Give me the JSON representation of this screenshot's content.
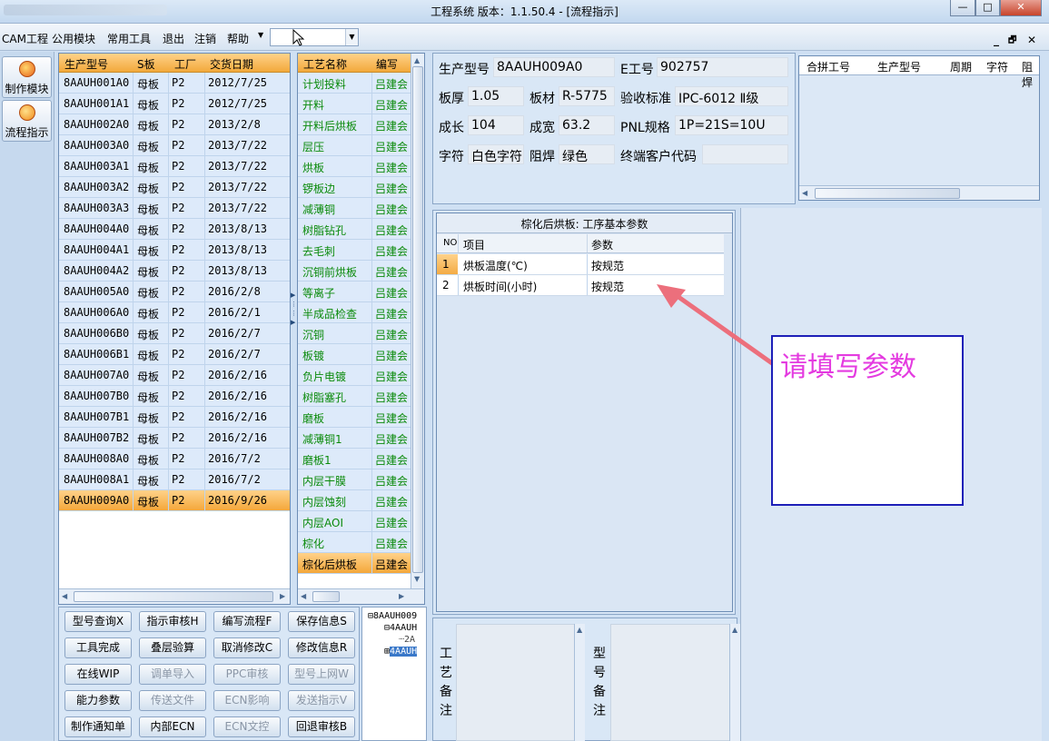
{
  "window": {
    "title": "工程系统  版本：1.1.50.4 - [流程指示]",
    "btn_min": "—",
    "btn_max": "□",
    "btn_close": "✕"
  },
  "menu": {
    "items": [
      "CAM工程",
      "公用模块",
      "常用工具",
      "退出",
      "注销",
      "帮助"
    ],
    "combo_value": "",
    "mdi_min": "_",
    "mdi_restore": "🗗",
    "mdi_close": "✕"
  },
  "sidebar": {
    "items": [
      {
        "label": "制作模块"
      },
      {
        "label": "流程指示"
      }
    ]
  },
  "product_table": {
    "columns": [
      "生产型号",
      "S板",
      "工厂",
      "交货日期"
    ],
    "rows": [
      [
        "8AAUH001A0",
        "母板",
        "P2",
        "2012/7/25"
      ],
      [
        "8AAUH001A1",
        "母板",
        "P2",
        "2012/7/25"
      ],
      [
        "8AAUH002A0",
        "母板",
        "P2",
        "2013/2/8"
      ],
      [
        "8AAUH003A0",
        "母板",
        "P2",
        "2013/7/22"
      ],
      [
        "8AAUH003A1",
        "母板",
        "P2",
        "2013/7/22"
      ],
      [
        "8AAUH003A2",
        "母板",
        "P2",
        "2013/7/22"
      ],
      [
        "8AAUH003A3",
        "母板",
        "P2",
        "2013/7/22"
      ],
      [
        "8AAUH004A0",
        "母板",
        "P2",
        "2013/8/13"
      ],
      [
        "8AAUH004A1",
        "母板",
        "P2",
        "2013/8/13"
      ],
      [
        "8AAUH004A2",
        "母板",
        "P2",
        "2013/8/13"
      ],
      [
        "8AAUH005A0",
        "母板",
        "P2",
        "2016/2/8"
      ],
      [
        "8AAUH006A0",
        "母板",
        "P2",
        "2016/2/1"
      ],
      [
        "8AAUH006B0",
        "母板",
        "P2",
        "2016/2/7"
      ],
      [
        "8AAUH006B1",
        "母板",
        "P2",
        "2016/2/7"
      ],
      [
        "8AAUH007A0",
        "母板",
        "P2",
        "2016/2/16"
      ],
      [
        "8AAUH007B0",
        "母板",
        "P2",
        "2016/2/16"
      ],
      [
        "8AAUH007B1",
        "母板",
        "P2",
        "2016/2/16"
      ],
      [
        "8AAUH007B2",
        "母板",
        "P2",
        "2016/2/16"
      ],
      [
        "8AAUH008A0",
        "母板",
        "P2",
        "2016/7/2"
      ],
      [
        "8AAUH008A1",
        "母板",
        "P2",
        "2016/7/2"
      ],
      [
        "8AAUH009A0",
        "母板",
        "P2",
        "2016/9/26"
      ]
    ],
    "selected_index": 20
  },
  "process_table": {
    "columns": [
      "工艺名称",
      "编写"
    ],
    "rows": [
      [
        "计划投料",
        "吕建会"
      ],
      [
        "开料",
        "吕建会"
      ],
      [
        "开料后烘板",
        "吕建会"
      ],
      [
        "层压",
        "吕建会"
      ],
      [
        "烘板",
        "吕建会"
      ],
      [
        "锣板边",
        "吕建会"
      ],
      [
        "减薄铜",
        "吕建会"
      ],
      [
        "树脂钻孔",
        "吕建会"
      ],
      [
        "去毛刺",
        "吕建会"
      ],
      [
        "沉铜前烘板",
        "吕建会"
      ],
      [
        "等离子",
        "吕建会"
      ],
      [
        "半成品检查",
        "吕建会"
      ],
      [
        "沉铜",
        "吕建会"
      ],
      [
        "板镀",
        "吕建会"
      ],
      [
        "负片电镀",
        "吕建会"
      ],
      [
        "树脂塞孔",
        "吕建会"
      ],
      [
        "磨板",
        "吕建会"
      ],
      [
        "减薄铜1",
        "吕建会"
      ],
      [
        "磨板1",
        "吕建会"
      ],
      [
        "内层干膜",
        "吕建会"
      ],
      [
        "内层蚀刻",
        "吕建会"
      ],
      [
        "内层AOI",
        "吕建会"
      ],
      [
        "棕化",
        "吕建会"
      ],
      [
        "棕化后烘板",
        "吕建会"
      ]
    ],
    "selected_index": 23
  },
  "info": {
    "model_label": "生产型号",
    "model_value": "8AAUH009A0",
    "eno_label": "E工号",
    "eno_value": "902757",
    "thick_label": "板厚",
    "thick_value": "1.05",
    "material_label": "板材",
    "material_value": "R-5775",
    "std_label": "验收标准",
    "std_value": "IPC-6012 Ⅱ级",
    "len_label": "成长",
    "len_value": "104",
    "wid_label": "成宽",
    "wid_value": "63.2",
    "pnl_label": "PNL规格",
    "pnl_value": "1P=21S=10U",
    "char_label": "字符",
    "char_value": "白色字符",
    "mask_label": "阻焊",
    "mask_value": "绿色",
    "cust_label": "终端客户代码",
    "cust_value": ""
  },
  "merge_table": {
    "columns": [
      "合拼工号",
      "生产型号",
      "周期",
      "字符",
      "阻焊"
    ]
  },
  "param_table": {
    "title": "棕化后烘板: 工序基本参数",
    "columns": [
      "NO",
      "项目",
      "参数"
    ],
    "rows": [
      [
        "1",
        "烘板温度(℃)",
        "按规范"
      ],
      [
        "2",
        "烘板时间(小时)",
        "按规范"
      ]
    ]
  },
  "annotation": {
    "text": "请填写参数",
    "arrow_color": "#ec6f7c",
    "box_border": "#1d1fb8",
    "text_color": "#e43be0"
  },
  "buttons": [
    [
      "型号查询X",
      "指示审核H",
      "编写流程F",
      "保存信息S"
    ],
    [
      "工具完成",
      "叠层验算",
      "取消修改C",
      "修改信息R"
    ],
    [
      "在线WIP",
      "调单导入",
      "PPC审核",
      "型号上网W"
    ],
    [
      "能力参数",
      "传送文件",
      "ECN影响",
      "发送指示V"
    ],
    [
      "制作通知单",
      "内部ECN",
      "ECN文控",
      "回退审核B"
    ]
  ],
  "buttons_disabled": [
    [
      false,
      false,
      false,
      false
    ],
    [
      false,
      false,
      false,
      false
    ],
    [
      false,
      true,
      true,
      true
    ],
    [
      false,
      true,
      true,
      true
    ],
    [
      false,
      false,
      true,
      false
    ]
  ],
  "tree": {
    "items": [
      "8AAUH009",
      "4AAUH",
      "2A",
      "4AAUH"
    ]
  },
  "remarks": {
    "process_label": "工艺备注",
    "model_label": "型号备注"
  }
}
